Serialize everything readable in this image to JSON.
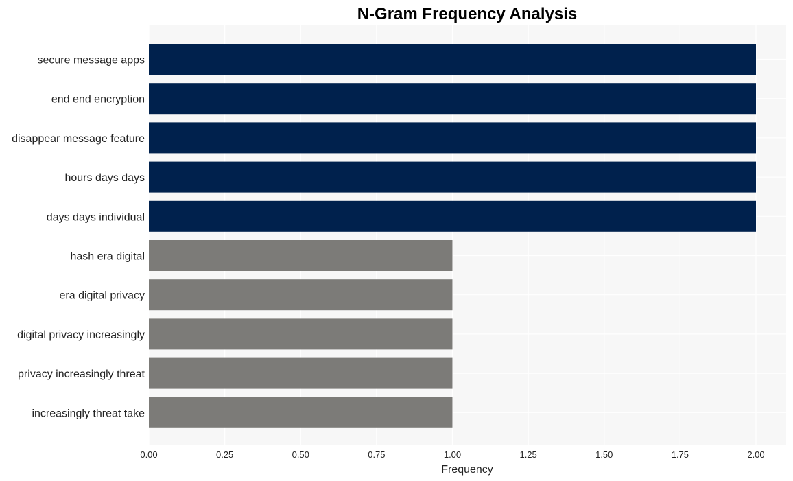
{
  "chart_data": {
    "type": "bar",
    "orientation": "horizontal",
    "title": "N-Gram Frequency Analysis",
    "xlabel": "Frequency",
    "ylabel": "",
    "xlim": [
      0,
      2.1
    ],
    "grid": true,
    "x_ticks": [
      "0.00",
      "0.25",
      "0.50",
      "0.75",
      "1.00",
      "1.25",
      "1.50",
      "1.75",
      "2.00"
    ],
    "x_tick_values": [
      0,
      0.25,
      0.5,
      0.75,
      1.0,
      1.25,
      1.5,
      1.75,
      2.0
    ],
    "categories": [
      "secure message apps",
      "end end encryption",
      "disappear message feature",
      "hours days days",
      "days days individual",
      "hash era digital",
      "era digital privacy",
      "digital privacy increasingly",
      "privacy increasingly threat",
      "increasingly threat take"
    ],
    "values": [
      2,
      2,
      2,
      2,
      2,
      1,
      1,
      1,
      1,
      1
    ],
    "colors": {
      "high": "#00214d",
      "low": "#7c7b78",
      "panel_background": "#f7f7f7",
      "grid": "#ffffff"
    }
  }
}
